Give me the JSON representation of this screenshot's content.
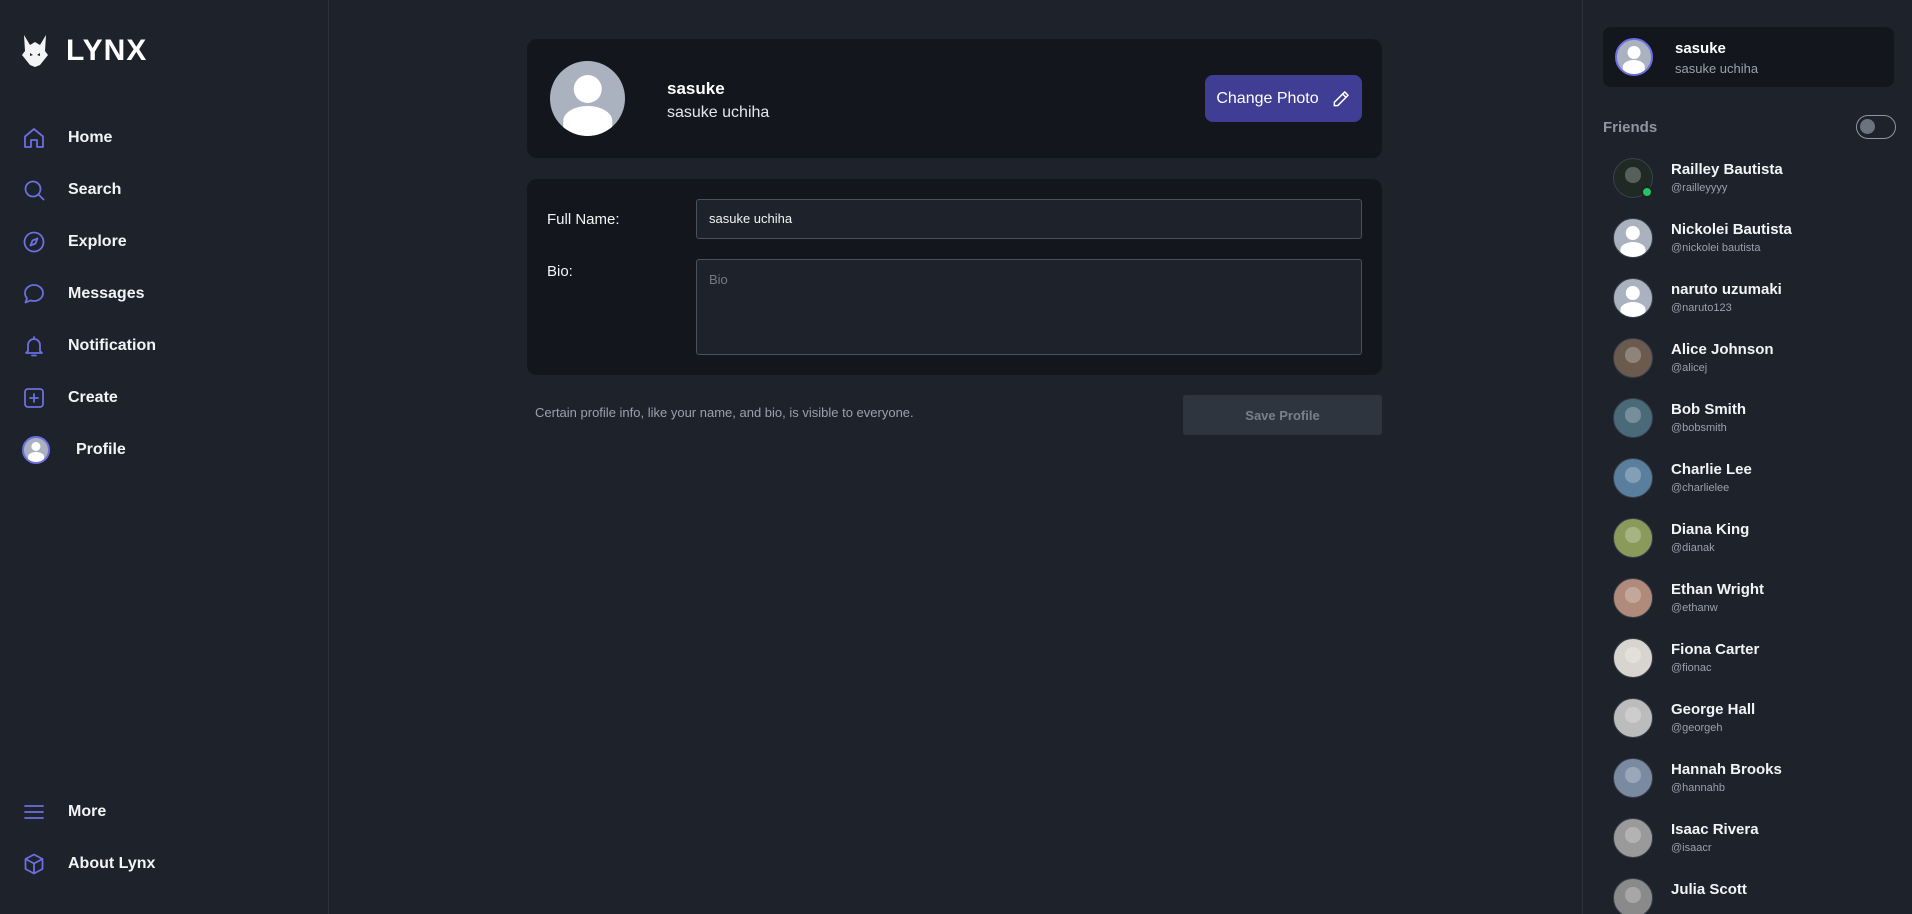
{
  "brand": {
    "name": "LYNX",
    "accent": "#6b6fe0"
  },
  "nav": {
    "items": [
      {
        "label": "Home",
        "icon": "home-icon"
      },
      {
        "label": "Search",
        "icon": "search-icon"
      },
      {
        "label": "Explore",
        "icon": "compass-icon"
      },
      {
        "label": "Messages",
        "icon": "message-icon"
      },
      {
        "label": "Notification",
        "icon": "bell-icon"
      },
      {
        "label": "Create",
        "icon": "plus-square-icon"
      },
      {
        "label": "Profile",
        "icon": "avatar"
      }
    ],
    "bottom": [
      {
        "label": "More",
        "icon": "menu-icon"
      },
      {
        "label": "About Lynx",
        "icon": "cube-icon"
      }
    ]
  },
  "profile": {
    "username": "sasuke",
    "full_name": "sasuke uchiha",
    "change_photo_label": "Change Photo"
  },
  "form": {
    "full_name_label": "Full Name:",
    "full_name_value": "sasuke uchiha",
    "bio_label": "Bio:",
    "bio_placeholder": "Bio",
    "note": "Certain profile info, like your name, and bio, is visible to everyone.",
    "save_label": "Save Profile"
  },
  "right": {
    "current_user": {
      "username": "sasuke",
      "full_name": "sasuke uchiha"
    },
    "friends_heading": "Friends",
    "friends": [
      {
        "name": "Railley Bautista",
        "handle": "@railleyyyy",
        "online": true,
        "color": "#1f2a24"
      },
      {
        "name": "Nickolei Bautista",
        "handle": "@nickolei bautista",
        "placeholder": true
      },
      {
        "name": "naruto uzumaki",
        "handle": "@naruto123",
        "placeholder": true
      },
      {
        "name": "Alice Johnson",
        "handle": "@alicej",
        "color": "#6b5a4e"
      },
      {
        "name": "Bob Smith",
        "handle": "@bobsmith",
        "color": "#4a6a7a"
      },
      {
        "name": "Charlie Lee",
        "handle": "@charlielee",
        "color": "#5a7f9e"
      },
      {
        "name": "Diana King",
        "handle": "@dianak",
        "color": "#8a9a5a"
      },
      {
        "name": "Ethan Wright",
        "handle": "@ethanw",
        "color": "#b08a7a"
      },
      {
        "name": "Fiona Carter",
        "handle": "@fionac",
        "color": "#d8d4d0"
      },
      {
        "name": "George Hall",
        "handle": "@georgeh",
        "color": "#bcbcbc"
      },
      {
        "name": "Hannah Brooks",
        "handle": "@hannahb",
        "color": "#7a8aa0"
      },
      {
        "name": "Isaac Rivera",
        "handle": "@isaacr",
        "color": "#9a9a9a"
      },
      {
        "name": "Julia Scott",
        "handle": "",
        "color": "#8a8a8a"
      }
    ]
  }
}
